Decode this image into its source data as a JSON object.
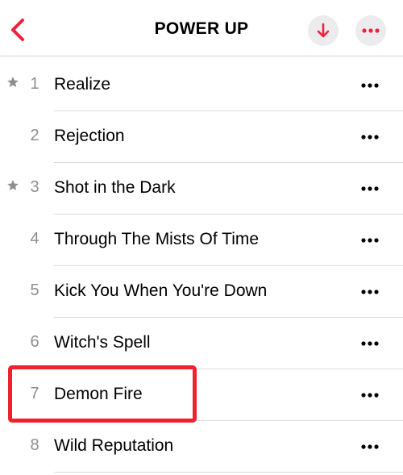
{
  "header": {
    "title": "POWER UP",
    "back_icon": "chevron-left-icon",
    "download_icon": "arrow-down-icon",
    "more_icon": "ellipsis-icon"
  },
  "colors": {
    "accent": "#f2203b",
    "highlight": "#f0212f",
    "track_number": "#8e8e93",
    "star": "#8e8e93",
    "button_bg": "#ececee"
  },
  "tracks": [
    {
      "number": "1",
      "title": "Realize",
      "starred": true
    },
    {
      "number": "2",
      "title": "Rejection",
      "starred": false
    },
    {
      "number": "3",
      "title": "Shot in the Dark",
      "starred": true
    },
    {
      "number": "4",
      "title": "Through The Mists Of Time",
      "starred": false
    },
    {
      "number": "5",
      "title": "Kick You When You're Down",
      "starred": false
    },
    {
      "number": "6",
      "title": "Witch's Spell",
      "starred": false
    },
    {
      "number": "7",
      "title": "Demon Fire",
      "starred": false,
      "highlighted": true
    },
    {
      "number": "8",
      "title": "Wild Reputation",
      "starred": false
    }
  ]
}
